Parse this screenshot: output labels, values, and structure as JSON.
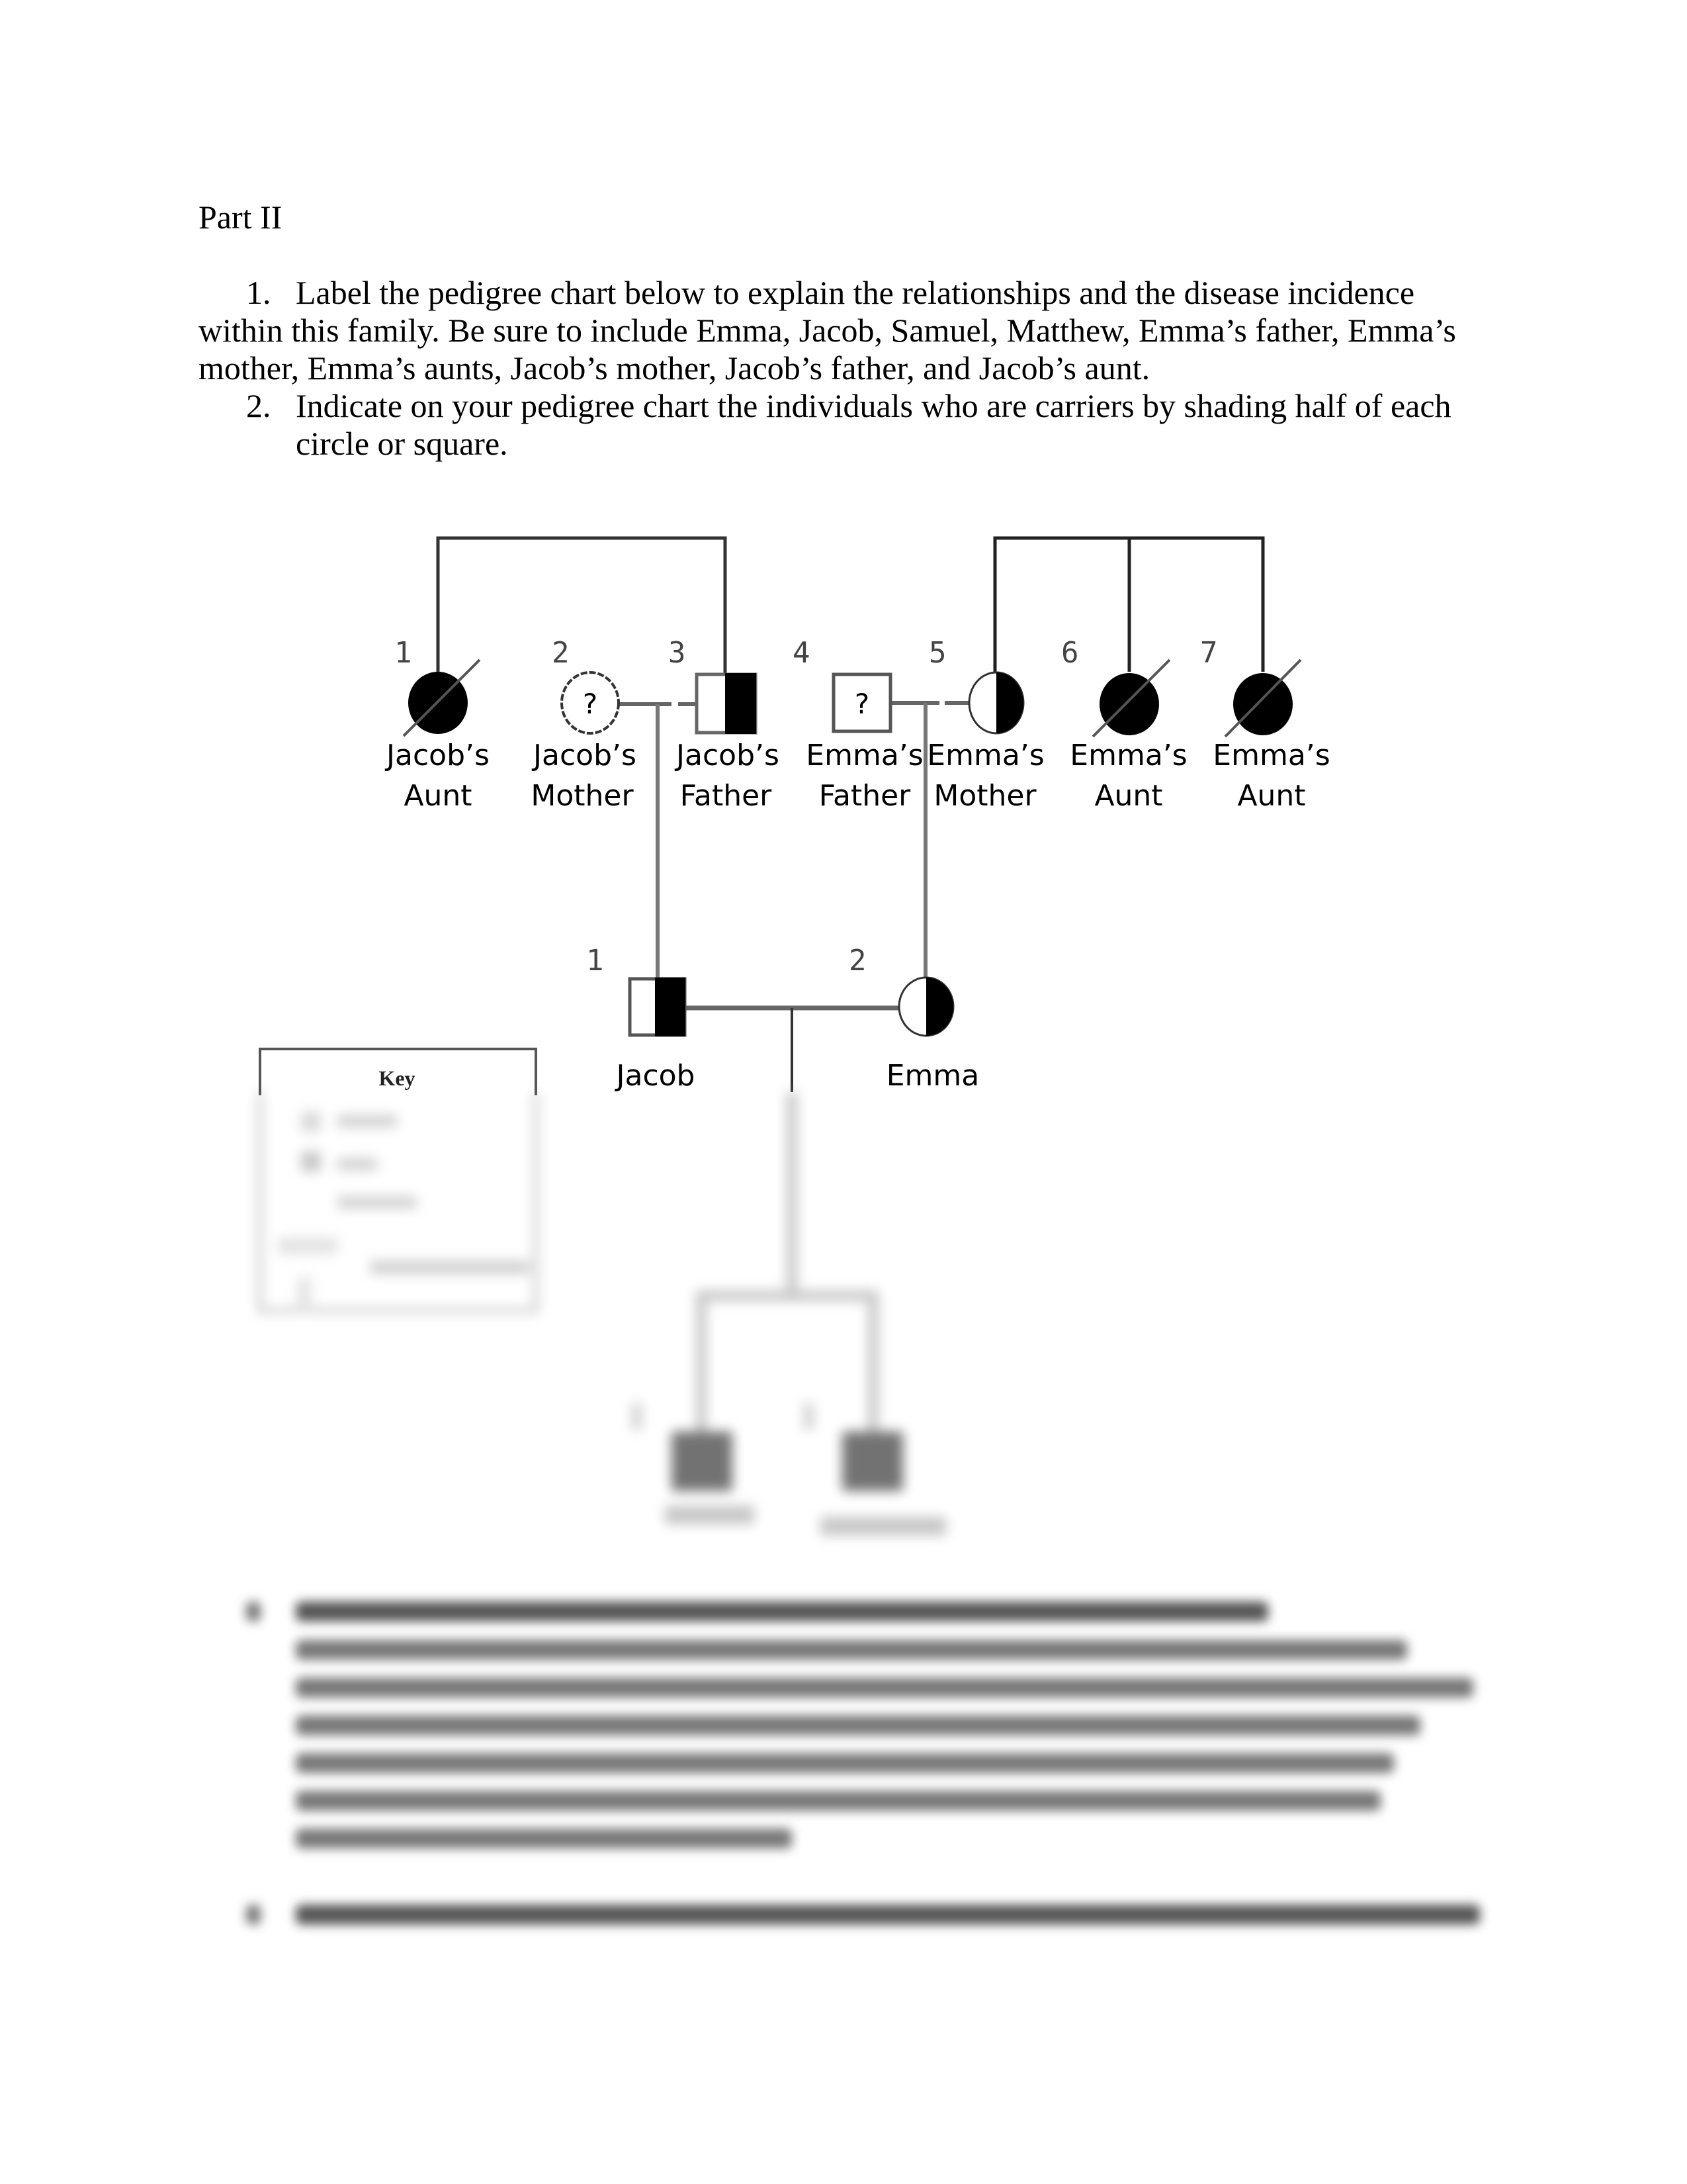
{
  "document": {
    "heading": "Part II",
    "instructions": [
      {
        "number": "1.",
        "lines": [
          "Label the pedigree chart below to explain the relationships and the disease incidence",
          "within this family.  Be sure to include Emma, Jacob, Samuel, Matthew, Emma’s father, Emma’s",
          "mother, Emma’s aunts, Jacob’s mother, Jacob’s father, and Jacob’s aunt."
        ]
      },
      {
        "number": "2.",
        "lines": [
          "Indicate on your pedigree chart the individuals who are carriers by shading half of each",
          "circle or square."
        ]
      }
    ]
  },
  "pedigree": {
    "generation_1": [
      {
        "number": "1",
        "label_line1": "Jacob’s",
        "label_line2": "Aunt",
        "sex": "female",
        "status": "affected",
        "deceased": true
      },
      {
        "number": "2",
        "label_line1": "Jacob’s",
        "label_line2": "Mother",
        "sex": "female",
        "status": "unknown",
        "symbol_text": "?"
      },
      {
        "number": "3",
        "label_line1": "Jacob’s",
        "label_line2": "Father",
        "sex": "male",
        "status": "carrier"
      },
      {
        "number": "4",
        "label_line1": "Emma’s",
        "label_line2": "Father",
        "sex": "male",
        "status": "unknown",
        "symbol_text": "?"
      },
      {
        "number": "5",
        "label_line1": "Emma’s",
        "label_line2": "Mother",
        "sex": "female",
        "status": "carrier"
      },
      {
        "number": "6",
        "label_line1": "Emma’s",
        "label_line2": "Aunt",
        "sex": "female",
        "status": "affected",
        "deceased": true
      },
      {
        "number": "7",
        "label_line1": "Emma’s",
        "label_line2": "Aunt",
        "sex": "female",
        "status": "affected",
        "deceased": true
      }
    ],
    "generation_2": [
      {
        "number": "1",
        "label": "Jacob",
        "sex": "male",
        "status": "carrier"
      },
      {
        "number": "2",
        "label": "Emma",
        "sex": "female",
        "status": "carrier"
      }
    ],
    "generation_3": [
      {
        "sex": "male",
        "status": "affected",
        "obscured": true
      },
      {
        "sex": "male",
        "status": "affected",
        "obscured": true
      }
    ],
    "key": {
      "title": "Key",
      "content_obscured": true
    }
  },
  "obscured_section": {
    "note": "Questions 3 and 4 are blurred and unreadable"
  }
}
